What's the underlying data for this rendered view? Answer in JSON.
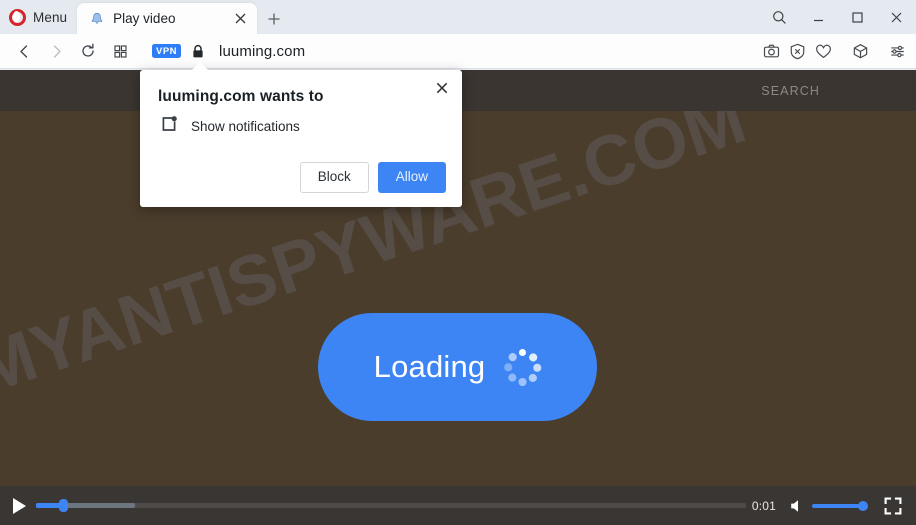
{
  "browser": {
    "menu_label": "Menu",
    "tabs": [
      {
        "title": "Play video",
        "favicon": "bell-icon",
        "close_label": "×"
      }
    ],
    "new_tab_label": "+",
    "window_controls": {
      "search": "search-icon",
      "minimize": "minimize-icon",
      "maximize": "maximize-icon",
      "close": "close-icon"
    },
    "toolbar": {
      "back": "back-arrow-icon",
      "forward": "forward-arrow-icon",
      "reload": "reload-icon",
      "tab_grid": "tab-grid-icon",
      "vpn_badge": "VPN",
      "lock": "lock-icon",
      "url": "luuming.com",
      "extensions": [
        "snapshot-camera-icon",
        "ad-blocker-shield-icon",
        "heart-icon",
        "cube-icon",
        "easy-setup-sliders-icon"
      ]
    }
  },
  "notification_dialog": {
    "title": "luuming.com wants to",
    "permission_icon": "notification-popup-icon",
    "permission_label": "Show notifications",
    "block_label": "Block",
    "allow_label": "Allow",
    "close_label": "×",
    "accent_color": "#3d85f4"
  },
  "page": {
    "background_color": "#4b3d2c",
    "header_background": "#3a3531",
    "search_label": "SEARCH",
    "watermark": "MYANTISPYWARE.COM",
    "loading_button": {
      "label": "Loading",
      "spinner": "dot-spinner-icon",
      "color": "#3d85f4"
    }
  },
  "player": {
    "play_label": "play-icon",
    "time_current": "0:01",
    "progress_percent": 4,
    "buffered_percent": 14,
    "volume_percent": 100,
    "volume_icon": "speaker-icon",
    "fullscreen_icon": "fullscreen-icon",
    "accent_color": "#3d85f4"
  }
}
